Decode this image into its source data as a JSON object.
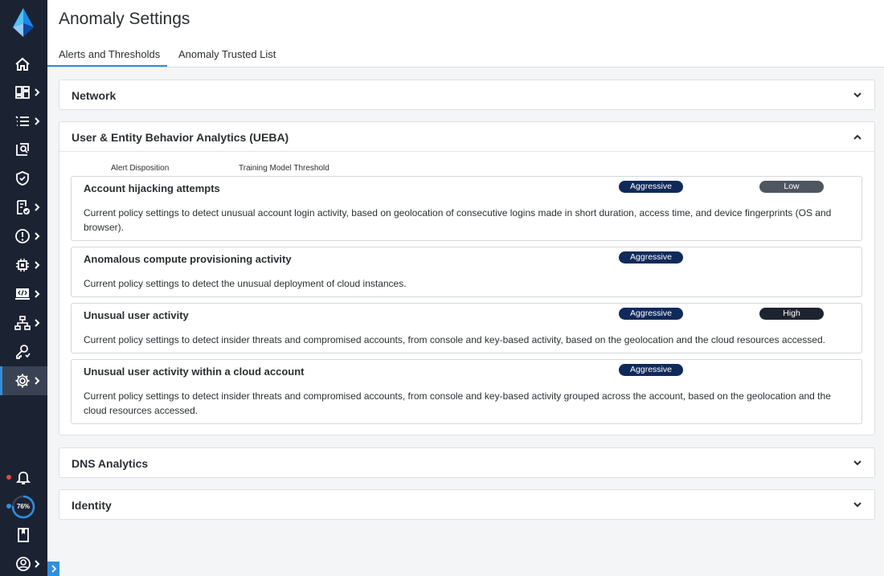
{
  "header": {
    "title": "Anomaly Settings",
    "tabs": [
      {
        "label": "Alerts and Thresholds",
        "active": true
      },
      {
        "label": "Anomaly Trusted List",
        "active": false
      }
    ]
  },
  "sidebar": {
    "progress": {
      "value": 76,
      "label": "76%"
    },
    "items": [
      {
        "icon": "home-icon"
      },
      {
        "icon": "dashboard-icon"
      },
      {
        "icon": "list-icon"
      },
      {
        "icon": "investigate-icon"
      },
      {
        "icon": "shield-check-icon"
      },
      {
        "icon": "compliance-icon"
      },
      {
        "icon": "alert-icon"
      },
      {
        "icon": "chip-icon"
      },
      {
        "icon": "code-icon"
      },
      {
        "icon": "network-icon"
      },
      {
        "icon": "access-icon"
      },
      {
        "icon": "gear-icon",
        "active": true
      },
      {
        "icon": "bell-icon"
      },
      {
        "icon": "book-icon"
      },
      {
        "icon": "user-icon"
      }
    ]
  },
  "colors": {
    "sidebar": "#1b2333",
    "accent": "#2f8fe0",
    "aggressive": "#0f2a5a",
    "low": "#4f5661",
    "high": "#1d2430"
  },
  "panels": {
    "network": {
      "title": "Network",
      "expanded": false
    },
    "ueba": {
      "title": "User & Entity Behavior Analytics (UEBA)",
      "expanded": true,
      "columns": {
        "disposition": "Alert Disposition",
        "threshold": "Training Model Threshold"
      },
      "policies": [
        {
          "name": "Account hijacking attempts",
          "disposition": "Aggressive",
          "threshold": "Low",
          "description": "Current policy settings to detect unusual account login activity, based on geolocation of consecutive logins made in short duration, access time, and device fingerprints (OS and browser)."
        },
        {
          "name": "Anomalous compute provisioning activity",
          "disposition": "Aggressive",
          "description": "Current policy settings to detect the unusual deployment of cloud instances."
        },
        {
          "name": "Unusual user activity",
          "disposition": "Aggressive",
          "threshold": "High",
          "description": "Current policy settings to detect insider threats and compromised accounts, from console and key-based activity, based on the geolocation and the cloud resources accessed."
        },
        {
          "name": "Unusual user activity within a cloud account",
          "disposition": "Aggressive",
          "description": "Current policy settings to detect insider threats and compromised accounts, from console and key-based activity grouped across the account, based on the geolocation and the cloud resources accessed."
        }
      ]
    },
    "dns": {
      "title": "DNS Analytics",
      "expanded": false
    },
    "identity": {
      "title": "Identity",
      "expanded": false
    }
  }
}
